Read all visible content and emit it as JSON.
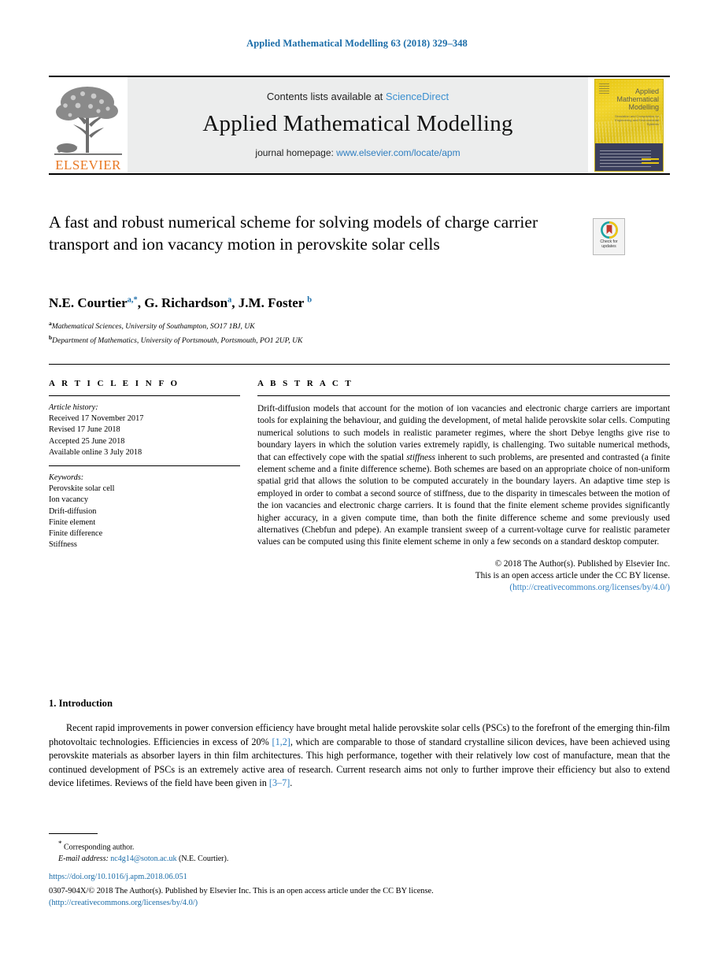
{
  "running_head": "Applied Mathematical Modelling 63 (2018) 329–348",
  "masthead": {
    "contents_prefix": "Contents lists available at ",
    "sciencedirect": "ScienceDirect",
    "journal_title": "Applied Mathematical Modelling",
    "homepage_prefix": "journal homepage: ",
    "homepage_url": "www.elsevier.com/locate/apm",
    "publisher_wordmark": "ELSEVIER",
    "cover": {
      "title_line1": "Applied",
      "title_line2": "Mathematical",
      "title_line3": "Modelling",
      "subtitle": "Simulation and Computation for Engineering and Environmental Systems"
    }
  },
  "article": {
    "title": "A fast and robust numerical scheme for solving models of charge carrier transport and ion vacancy motion in perovskite solar cells",
    "crossmark_line1": "Check for",
    "crossmark_line2": "updates",
    "authors_html": "N.E. Courtier<sup>a,*</sup>, G. Richardson<sup>a</sup>, J.M. Foster <sup>b</sup>",
    "affiliation_a": "Mathematical Sciences, University of Southampton, SO17 1BJ, UK",
    "affiliation_b": "Department of Mathematics, University of Portsmouth, Portsmouth, PO1 2UP, UK",
    "affiliation_a_mark": "a",
    "affiliation_b_mark": "b"
  },
  "info": {
    "heading": "A R T I C L E    I N F O",
    "history_label": "Article history:",
    "history": [
      "Received 17 November 2017",
      "Revised 17 June 2018",
      "Accepted 25 June 2018",
      "Available online 3 July 2018"
    ],
    "keywords_label": "Keywords:",
    "keywords": [
      "Perovskite solar cell",
      "Ion vacancy",
      "Drift-diffusion",
      "Finite element",
      "Finite difference",
      "Stiffness"
    ]
  },
  "abstract": {
    "heading": "A B S T R A C T",
    "part1": "Drift-diffusion models that account for the motion of ion vacancies and electronic charge carriers are important tools for explaining the behaviour, and guiding the development, of metal halide perovskite solar cells. Computing numerical solutions to such models in realistic parameter regimes, where the short Debye lengths give rise to boundary layers in which the solution varies extremely rapidly, is challenging. Two suitable numerical methods, that can effectively cope with the spatial ",
    "italic_word": "stiffness",
    "part2": " inherent to such problems, are presented and contrasted (a finite element scheme and a finite difference scheme). Both schemes are based on an appropriate choice of non-uniform spatial grid that allows the solution to be computed accurately in the boundary layers. An adaptive time step is employed in order to combat a second source of stiffness, due to the disparity in timescales between the motion of the ion vacancies and electronic charge carriers. It is found that the finite element scheme provides significantly higher accuracy, in a given compute time, than both the finite difference scheme and some previously used alternatives (Chebfun and pdepe). An example transient sweep of a current-voltage curve for realistic parameter values can be computed using this finite element scheme in only a few seconds on a standard desktop computer.",
    "copyright_line1": "© 2018 The Author(s). Published by Elsevier Inc.",
    "copyright_line2": "This is an open access article under the CC BY license.",
    "copyright_line3": "(http://creativecommons.org/licenses/by/4.0/)"
  },
  "introduction": {
    "heading": "1. Introduction",
    "paragraph_a": "Recent rapid improvements in power conversion efficiency have brought metal halide perovskite solar cells (PSCs) to the forefront of the emerging thin-film photovoltaic technologies. Efficiencies in excess of 20% ",
    "citation_1": "[1,2]",
    "paragraph_b": ", which are comparable to those of standard crystalline silicon devices, have been achieved using perovskite materials as absorber layers in thin film architectures. This high performance, together with their relatively low cost of manufacture, mean that the continued development of PSCs is an extremely active area of research. Current research aims not only to further improve their efficiency but also to extend device lifetimes. Reviews of the field have been given in ",
    "citation_2": "[3–7]",
    "paragraph_c": "."
  },
  "footer": {
    "corresponding_star": "*",
    "corresponding_author": " Corresponding author.",
    "email_label": "E-mail address:",
    "email": "nc4g14@soton.ac.uk",
    "email_owner": " (N.E. Courtier).",
    "doi": "https://doi.org/10.1016/j.apm.2018.06.051",
    "issn_text": "0307-904X/© 2018 The Author(s). Published by Elsevier Inc. This is an open access article under the CC BY license.",
    "issn_license": "(http://creativecommons.org/licenses/by/4.0/)"
  },
  "colors": {
    "link_blue": "#2f7fc1",
    "header_blue": "#1a6ca8",
    "elsevier_orange": "#E87722",
    "cover_yellow": "#e8c714"
  }
}
